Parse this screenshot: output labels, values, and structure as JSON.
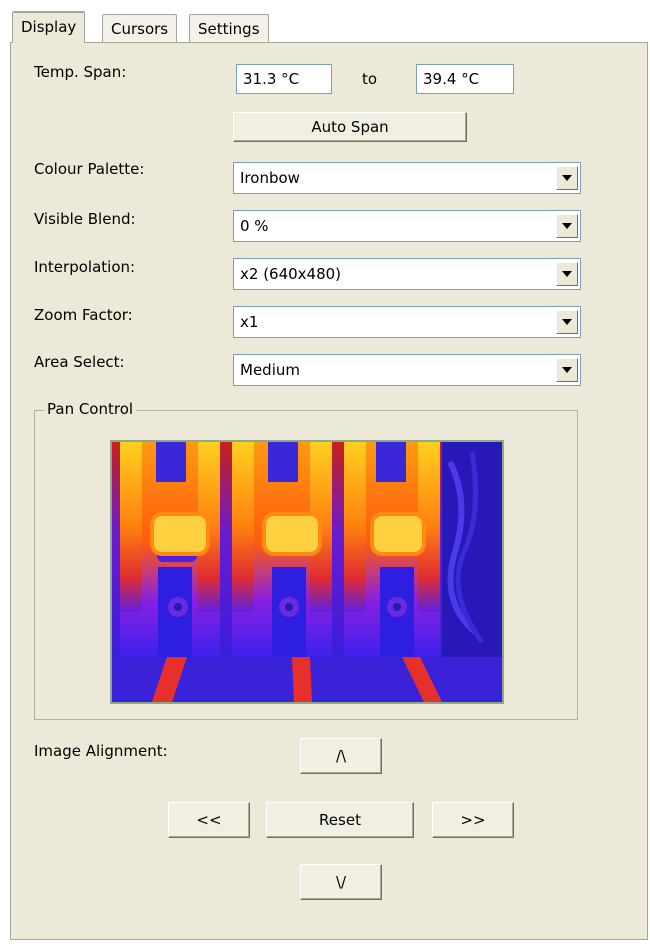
{
  "tabs": [
    {
      "label": "Display",
      "active": true
    },
    {
      "label": "Cursors",
      "active": false
    },
    {
      "label": "Settings",
      "active": false
    }
  ],
  "temp_span": {
    "label": "Temp. Span:",
    "low": "31.3 °C",
    "to": "to",
    "high": "39.4 °C"
  },
  "auto_span_label": "Auto Span",
  "colour_palette": {
    "label": "Colour Palette:",
    "value": "Ironbow"
  },
  "visible_blend": {
    "label": "Visible Blend:",
    "value": "0 %"
  },
  "interpolation": {
    "label": "Interpolation:",
    "value": "x2 (640x480)"
  },
  "zoom_factor": {
    "label": "Zoom Factor:",
    "value": "x1"
  },
  "area_select": {
    "label": "Area Select:",
    "value": "Medium"
  },
  "pan_control": {
    "label": "Pan Control"
  },
  "image_alignment": {
    "label": "Image Alignment:",
    "up": "/\\",
    "left": "<<",
    "reset": "Reset",
    "right": ">>",
    "down": "\\/"
  },
  "colors": {
    "panel_bg": "#ece9d8",
    "field_border": "#7f9db9"
  }
}
